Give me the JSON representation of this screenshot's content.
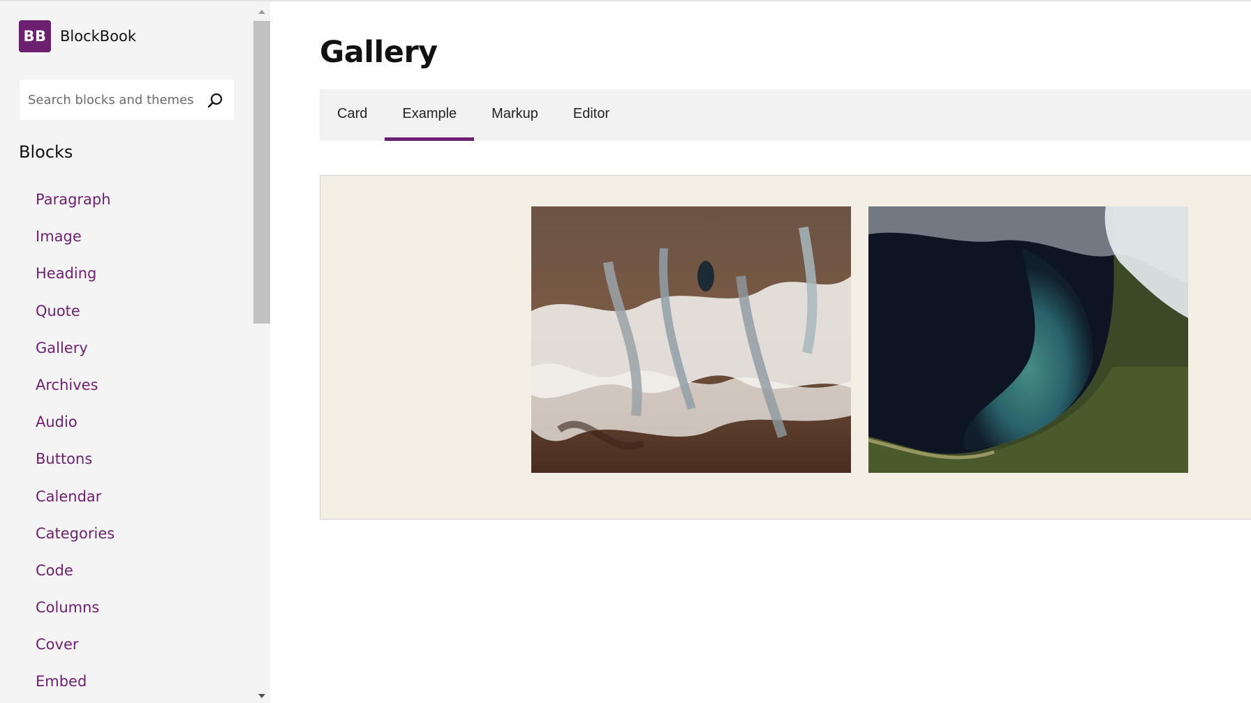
{
  "app": {
    "logo_text": "BB",
    "name": "BlockBook"
  },
  "sidebar": {
    "search": {
      "placeholder": "Search blocks and themes",
      "value": ""
    },
    "section_title": "Blocks",
    "items": [
      {
        "label": "Paragraph"
      },
      {
        "label": "Image"
      },
      {
        "label": "Heading"
      },
      {
        "label": "Quote"
      },
      {
        "label": "Gallery"
      },
      {
        "label": "Archives"
      },
      {
        "label": "Audio"
      },
      {
        "label": "Buttons"
      },
      {
        "label": "Calendar"
      },
      {
        "label": "Categories"
      },
      {
        "label": "Code"
      },
      {
        "label": "Columns"
      },
      {
        "label": "Cover"
      },
      {
        "label": "Embed"
      }
    ]
  },
  "main": {
    "title": "Gallery",
    "tabs": [
      {
        "label": "Card",
        "active": false
      },
      {
        "label": "Example",
        "active": true
      },
      {
        "label": "Markup",
        "active": false
      },
      {
        "label": "Editor",
        "active": false
      }
    ],
    "gallery": {
      "images": [
        {
          "subject": "satellite-glaciers"
        },
        {
          "subject": "satellite-lake-sediment"
        }
      ]
    }
  },
  "colors": {
    "brand": "#6d1f70",
    "sidebar_bg": "#f4f4f4",
    "tabs_bg": "#f2f2f2",
    "example_bg": "#f3efe4"
  }
}
